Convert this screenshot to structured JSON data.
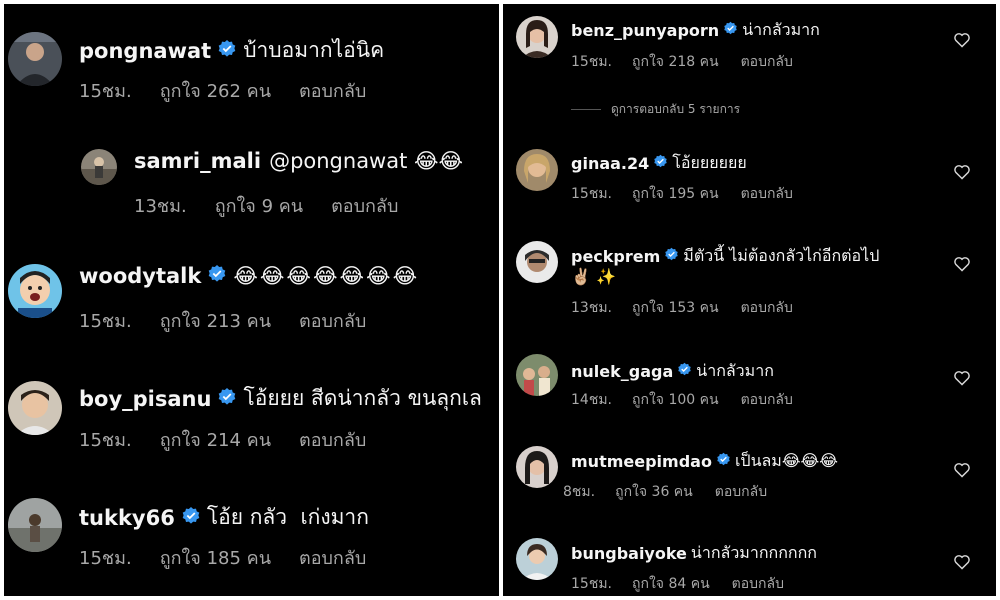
{
  "left_comments": [
    {
      "username": "pongnawat",
      "text": "บ้าบอมากไอ่นิค",
      "time": "15ชม.",
      "likes": "ถูกใจ 262 คน",
      "reply": "ตอบกลับ",
      "icon": "avatar-man-suit"
    },
    {
      "username": "samri_mali",
      "text": "@pongnawat 😂😂",
      "time": "13ชม.",
      "likes": "ถูกใจ 9 คน",
      "reply": "ตอบกลับ",
      "icon": "avatar-outdoor"
    },
    {
      "username": "woodytalk",
      "text": "😂😂😂😂😂😂😂",
      "time": "15ชม.",
      "likes": "ถูกใจ 213 คน",
      "reply": "ตอบกลับ",
      "icon": "avatar-cartoon"
    },
    {
      "username": "boy_pisanu",
      "text": "โอ้ยยย สีดน่ากลัว ขนลุกเล",
      "time": "15ชม.",
      "likes": "ถูกใจ 214 คน",
      "reply": "ตอบกลับ",
      "icon": "avatar-man"
    },
    {
      "username": "tukky66",
      "text": "โอ้ย กลัว  เก่งมาก",
      "time": "15ชม.",
      "likes": "ถูกใจ 185 คน",
      "reply": "ตอบกลับ",
      "icon": "avatar-landscape"
    }
  ],
  "right_comments": [
    {
      "username": "benz_punyaporn",
      "text": "น่ากลัวมาก",
      "time": "15ชม.",
      "likes": "ถูกใจ 218 คน",
      "reply": "ตอบกลับ",
      "icon": "avatar-woman"
    },
    {
      "username": "ginaa.24",
      "text": "โอ้ยยยยยย",
      "time": "15ชม.",
      "likes": "ถูกใจ 195 คน",
      "reply": "ตอบกลับ",
      "icon": "avatar-woman-blonde"
    },
    {
      "username": "peckprem",
      "text": "มีตัวนี้ ไม่ต้องกลัวไก่อีกต่อไป",
      "text2": "✌🏼 ✨",
      "time": "13ชม.",
      "likes": "ถูกใจ 153 คน",
      "reply": "ตอบกลับ",
      "icon": "avatar-woman-hat"
    },
    {
      "username": "nulek_gaga",
      "text": "น่ากลัวมาก",
      "time": "14ชม.",
      "likes": "ถูกใจ 100 คน",
      "reply": "ตอบกลับ",
      "icon": "avatar-group"
    },
    {
      "username": "mutmeepimdao",
      "text": "เป็นลม😂😂😂",
      "time": "8ชม.",
      "likes": "ถูกใจ 36 คน",
      "reply": "ตอบกลับ",
      "icon": "avatar-woman-dark"
    },
    {
      "username": "bungbaiyoke",
      "text": "น่ากลัวมากกกกกก",
      "time": "15ชม.",
      "likes": "ถูกใจ 84 คน",
      "reply": "ตอบกลับ",
      "icon": "avatar-woman-light"
    }
  ],
  "view_replies": "ดูการตอบกลับ 5 รายการ",
  "colors": {
    "background": "#000000",
    "text": "#f5f5f5",
    "meta": "#a8a8a8",
    "verified": "#3897f0"
  }
}
